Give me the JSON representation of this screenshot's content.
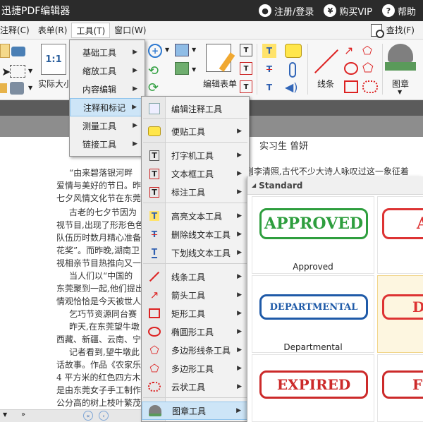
{
  "app": {
    "title": "迅捷PDF编辑器",
    "register_login": "注册/登录",
    "buy_vip": "购买VIP",
    "help": "帮助"
  },
  "menubar": {
    "items": [
      "注释(C)",
      "表单(R)",
      "工具(T)",
      "窗口(W)"
    ],
    "find_label": "查找(F)"
  },
  "ribbon": {
    "actual_size": "实际大小",
    "fit_label": "1:1",
    "edit_form": "编辑表单",
    "lines": "线条",
    "stamp": "图章"
  },
  "document": {
    "header": "实习生  曾妍",
    "lines": [
      "“由来碧落银河畔",
      "爱情与美好的节日。昨",
      "七夕风情文化节在东莞",
      "古老的七夕节因为",
      "视节目,出现了形形色色",
      "队伍历时数月精心准备",
      "花奖”。而昨晚,湖南卫",
      "视相亲节目热推向又一",
      "当人们以“中国的",
      "东莞聚到一起,他们提出",
      "情观恰恰是今天被世人",
      "乞巧节资源同台赛",
      "昨天,在东莞望牛墩",
      "西藏、新疆、云南、宁",
      "记者看到,望牛墩此",
      "话故事。作品《农家乐",
      "4 平方米的红色四方木",
      "是由东莞女子手工制作",
      "公分高的树上枝叶繁茂",
      "……"
    ],
    "overflow_line": "到李清照,古代不少大诗人咏叹过这一象征着"
  },
  "tools_menu": {
    "items": [
      {
        "label": "基础工具"
      },
      {
        "label": "缩放工具"
      },
      {
        "label": "内容编辑"
      },
      {
        "label": "注释和标记"
      },
      {
        "label": "测量工具"
      },
      {
        "label": "链接工具"
      }
    ]
  },
  "annot_menu": {
    "items": [
      {
        "label": "编辑注释工具",
        "icon": "edit-annotation-icon",
        "submenu": false
      },
      {
        "label": "便贴工具",
        "icon": "sticky-note-icon",
        "submenu": true
      },
      {
        "label": "打字机工具",
        "icon": "typewriter-icon",
        "submenu": true
      },
      {
        "label": "文本框工具",
        "icon": "textbox-icon",
        "submenu": true
      },
      {
        "label": "标注工具",
        "icon": "callout-icon",
        "submenu": true
      },
      {
        "label": "高亮文本工具",
        "icon": "highlight-icon",
        "submenu": true
      },
      {
        "label": "删除线文本工具",
        "icon": "strikethrough-icon",
        "submenu": true
      },
      {
        "label": "下划线文本工具",
        "icon": "underline-icon",
        "submenu": true
      },
      {
        "label": "线条工具",
        "icon": "line-icon",
        "submenu": true
      },
      {
        "label": "箭头工具",
        "icon": "arrow-icon",
        "submenu": true
      },
      {
        "label": "矩形工具",
        "icon": "rectangle-icon",
        "submenu": true
      },
      {
        "label": "椭圆形工具",
        "icon": "ellipse-icon",
        "submenu": true
      },
      {
        "label": "多边形线条工具",
        "icon": "polyline-icon",
        "submenu": true
      },
      {
        "label": "多边形工具",
        "icon": "polygon-icon",
        "submenu": true
      },
      {
        "label": "云状工具",
        "icon": "cloud-icon",
        "submenu": true
      },
      {
        "label": "图章工具",
        "icon": "stamp-icon",
        "submenu": true
      }
    ]
  },
  "stamp_panel": {
    "header": "Standard",
    "stamps": [
      {
        "text": "APPROVED",
        "caption": "Approved",
        "color": "#2e9e3e"
      },
      {
        "text": "DEPARTMENTAL",
        "caption": "Departmental",
        "color": "#1f5aa8"
      },
      {
        "text": "EXPIRED",
        "caption": "",
        "color": "#cc2a2a"
      }
    ],
    "partial": [
      "A",
      "D",
      "F"
    ]
  },
  "colors": {
    "titlebar": "#2b2b2b",
    "highlight": "#cde5f7",
    "approved": "#2e9e3e",
    "departmental": "#1f5aa8",
    "expired": "#cc2a2a"
  }
}
